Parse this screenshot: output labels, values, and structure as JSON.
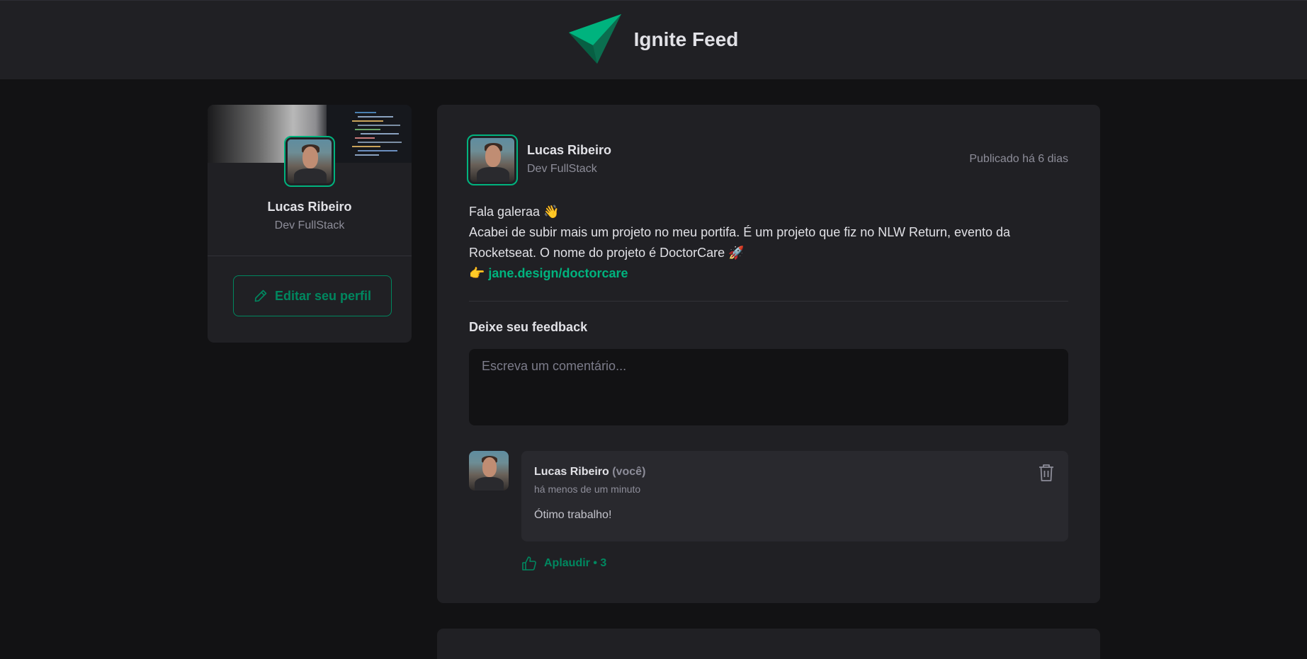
{
  "app": {
    "title": "Ignite Feed",
    "logo_icon": "ignite-logo-icon"
  },
  "colors": {
    "accent": "#00b37e",
    "accent_dark": "#00875f",
    "background": "#121214",
    "card": "#202024"
  },
  "profile": {
    "name": "Lucas Ribeiro",
    "role": "Dev FullStack",
    "edit_label": "Editar seu perfil",
    "edit_icon": "pencil-icon"
  },
  "post": {
    "author": {
      "name": "Lucas Ribeiro",
      "role": "Dev FullStack"
    },
    "published": "Publicado há 6 dias",
    "content": {
      "line1": "Fala galeraa 👋",
      "line2": "Acabei de subir mais um projeto no meu portifa. É um projeto que fiz no NLW Return, evento da Rocketseat. O nome do projeto é DoctorCare 🚀",
      "link_prefix": "👉 ",
      "link_text": "jane.design/doctorcare"
    },
    "feedback": {
      "title": "Deixe seu feedback",
      "placeholder": "Escreva um comentário..."
    },
    "comments": [
      {
        "author": "Lucas Ribeiro",
        "you_label": "(você)",
        "time": "há menos de um minuto",
        "text": "Ótimo trabalho!",
        "delete_icon": "trash-icon",
        "applaud_label": "Aplaudir",
        "applaud_separator": " • ",
        "applaud_count": "3",
        "applaud_icon": "thumbs-up-icon"
      }
    ]
  }
}
